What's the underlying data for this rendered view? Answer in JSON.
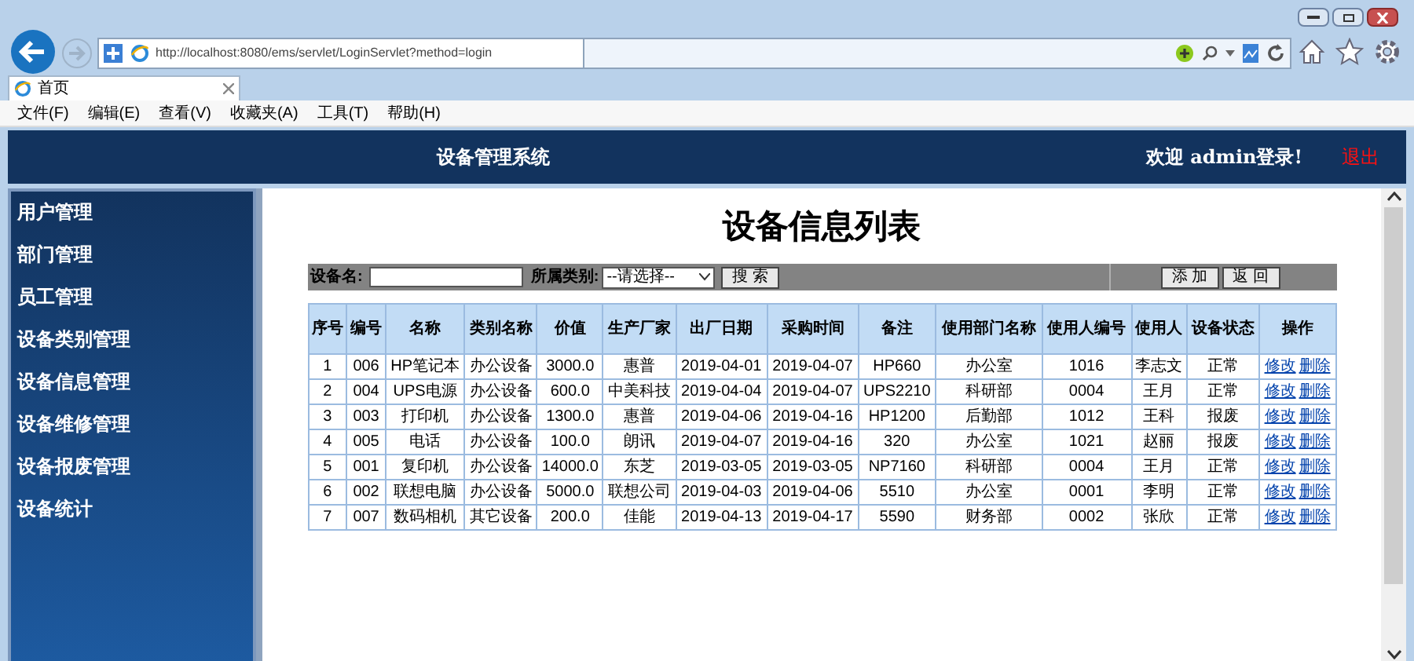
{
  "browser": {
    "address": "http://localhost:8080/ems/servlet/LoginServlet?method=login",
    "tab": {
      "label": "首页",
      "selected": true
    },
    "menu": [
      "文件(F)",
      "编辑(E)",
      "查看(V)",
      "收藏夹(A)",
      "工具(T)",
      "帮助(H)"
    ]
  },
  "header": {
    "title": "设备管理系统",
    "welcome": "欢迎 admin登录!",
    "logout": "退出"
  },
  "sidebar": {
    "items": [
      "用户管理",
      "部门管理",
      "员工管理",
      "设备类别管理",
      "设备信息管理",
      "设备维修管理",
      "设备报废管理",
      "设备统计"
    ]
  },
  "page_title": "设备信息列表",
  "search": {
    "name_label": "设备名:",
    "category_label": "所属类别:",
    "category_value": "--请选择--",
    "search_button": "搜 索",
    "add_button": "添 加",
    "back_button": "返 回"
  },
  "table": {
    "columns": [
      "序号",
      "编号",
      "名称",
      "类别名称",
      "价值",
      "生产厂家",
      "出厂日期",
      "采购时间",
      "备注",
      "使用部门名称",
      "使用人编号",
      "使用人",
      "设备状态",
      "操作"
    ],
    "rows": [
      {
        "cells": [
          "1",
          "006",
          "HP笔记本",
          "办公设备",
          "3000.0",
          "惠普",
          "2019-04-01",
          "2019-04-07",
          "HP660",
          "办公室",
          "1016",
          "李志文",
          "正常"
        ],
        "actions": [
          "修改",
          "删除"
        ]
      },
      {
        "cells": [
          "2",
          "004",
          "UPS电源",
          "办公设备",
          "600.0",
          "中美科技",
          "2019-04-04",
          "2019-04-07",
          "UPS2210",
          "科研部",
          "0004",
          "王月",
          "正常"
        ],
        "actions": [
          "修改",
          "删除"
        ]
      },
      {
        "cells": [
          "3",
          "003",
          "打印机",
          "办公设备",
          "1300.0",
          "惠普",
          "2019-04-06",
          "2019-04-16",
          "HP1200",
          "后勤部",
          "1012",
          "王科",
          "报废"
        ],
        "actions": [
          "修改",
          "删除"
        ]
      },
      {
        "cells": [
          "4",
          "005",
          "电话",
          "办公设备",
          "100.0",
          "朗讯",
          "2019-04-07",
          "2019-04-16",
          "320",
          "办公室",
          "1021",
          "赵丽",
          "报废"
        ],
        "actions": [
          "修改",
          "删除"
        ]
      },
      {
        "cells": [
          "5",
          "001",
          "复印机",
          "办公设备",
          "14000.0",
          "东芝",
          "2019-03-05",
          "2019-03-05",
          "NP7160",
          "科研部",
          "0004",
          "王月",
          "正常"
        ],
        "actions": [
          "修改",
          "删除"
        ]
      },
      {
        "cells": [
          "6",
          "002",
          "联想电脑",
          "办公设备",
          "5000.0",
          "联想公司",
          "2019-04-03",
          "2019-04-06",
          "5510",
          "办公室",
          "0001",
          "李明",
          "正常"
        ],
        "actions": [
          "修改",
          "删除"
        ]
      },
      {
        "cells": [
          "7",
          "007",
          "数码相机",
          "其它设备",
          "200.0",
          "佳能",
          "2019-04-13",
          "2019-04-17",
          "5590",
          "财务部",
          "0002",
          "张欣",
          "正常"
        ],
        "actions": [
          "修改",
          "删除"
        ]
      }
    ]
  }
}
